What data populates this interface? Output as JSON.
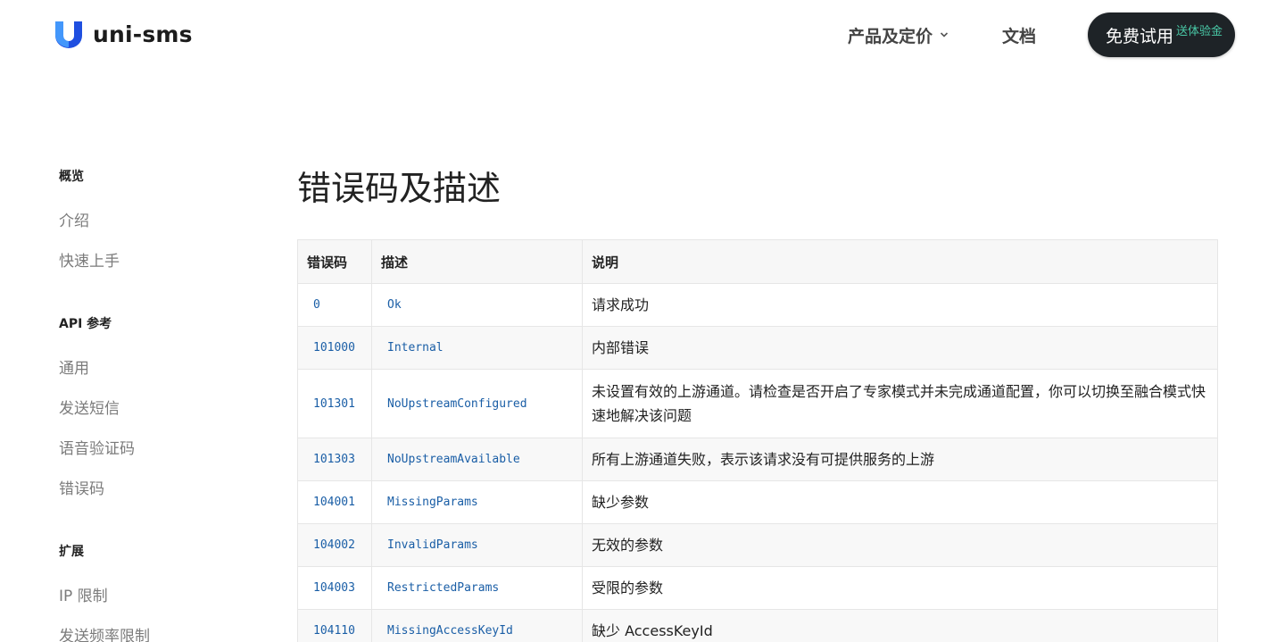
{
  "brand": {
    "name": "uni-sms",
    "accent": "#1f4fe0"
  },
  "nav": {
    "products_label": "产品及定价",
    "docs_label": "文档",
    "trial_label": "免费试用",
    "trial_badge": "送体验金"
  },
  "sidebar": {
    "sections": [
      {
        "heading": "概览",
        "items": [
          "介绍",
          "快速上手"
        ]
      },
      {
        "heading": "API 参考",
        "items": [
          "通用",
          "发送短信",
          "语音验证码",
          "错误码"
        ]
      },
      {
        "heading": "扩展",
        "items": [
          "IP 限制",
          "发送频率限制"
        ]
      }
    ]
  },
  "main": {
    "title": "错误码及描述",
    "table": {
      "headers": [
        "错误码",
        "描述",
        "说明"
      ],
      "rows": [
        {
          "code": "0",
          "name": "Ok",
          "desc": "请求成功"
        },
        {
          "code": "101000",
          "name": "Internal",
          "desc": "内部错误"
        },
        {
          "code": "101301",
          "name": "NoUpstreamConfigured",
          "desc": "未设置有效的上游通道。请检查是否开启了专家模式并未完成通道配置，你可以切换至融合模式快速地解决该问题"
        },
        {
          "code": "101303",
          "name": "NoUpstreamAvailable",
          "desc": "所有上游通道失败，表示该请求没有可提供服务的上游"
        },
        {
          "code": "104001",
          "name": "MissingParams",
          "desc": "缺少参数"
        },
        {
          "code": "104002",
          "name": "InvalidParams",
          "desc": "无效的参数"
        },
        {
          "code": "104003",
          "name": "RestrictedParams",
          "desc": "受限的参数"
        },
        {
          "code": "104110",
          "name": "MissingAccessKeyId",
          "desc": "缺少 AccessKeyId"
        }
      ]
    }
  }
}
